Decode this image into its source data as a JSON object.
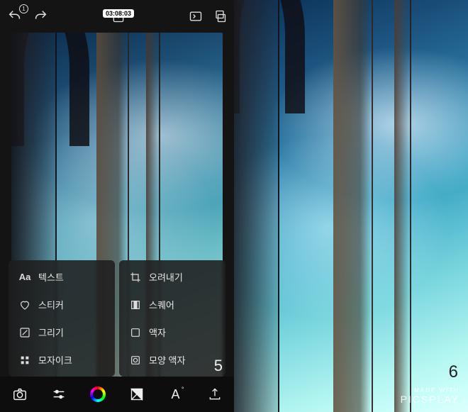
{
  "topbar": {
    "undo_count": "1",
    "timestamp_badge": "03:08:03"
  },
  "popup": {
    "left": [
      {
        "icon": "text-icon",
        "label": "텍스트"
      },
      {
        "icon": "heart-icon",
        "label": "스티커"
      },
      {
        "icon": "draw-icon",
        "label": "그리기"
      },
      {
        "icon": "mosaic-icon",
        "label": "모자이크"
      }
    ],
    "right": [
      {
        "icon": "crop-icon",
        "label": "오려내기"
      },
      {
        "icon": "square-icon",
        "label": "스퀘어"
      },
      {
        "icon": "frame-icon",
        "label": "액자"
      },
      {
        "icon": "shape-frame-icon",
        "label": "모양 액자"
      }
    ],
    "page_number": "5"
  },
  "output": {
    "page_number": "6",
    "watermark_top": "MADE WITH",
    "watermark_brand": "PICSPLAY"
  }
}
